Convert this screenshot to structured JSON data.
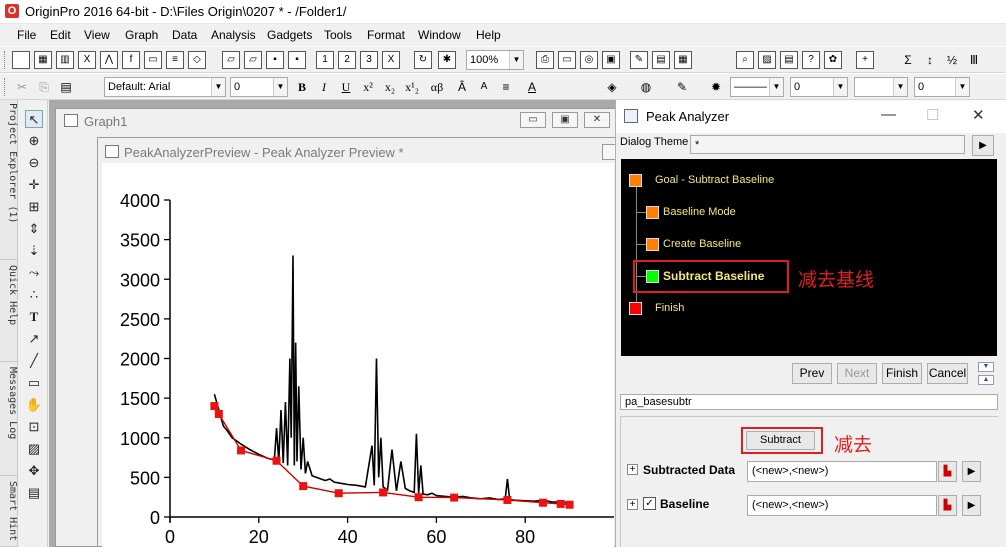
{
  "titlebar": {
    "title": "OriginPro 2016 64-bit - D:\\Files Origin\\0207 * - /Folder1/"
  },
  "menu": [
    "File",
    "Edit",
    "View",
    "Graph",
    "Data",
    "Analysis",
    "Gadgets",
    "Tools",
    "Format",
    "Window",
    "Help"
  ],
  "toolbar": {
    "zoom": "100%",
    "font": "Default: Arial",
    "font_size": "0",
    "text_style": [
      "B",
      "I",
      "U",
      "x²",
      "x₂",
      "x¹₂",
      "αβ",
      "Â",
      "A",
      "A",
      "≡"
    ],
    "line_combo": "0",
    "line_combo2": "0",
    "fill_combo": "0"
  },
  "side_tabs": [
    "Project Explorer (1)",
    "Quick Help",
    "Messages Log",
    "Smart Hint"
  ],
  "graph_window": {
    "title": "Graph1"
  },
  "preview_window": {
    "title": "PeakAnalyzerPreview - Peak Analyzer Preview *"
  },
  "chart_data": {
    "type": "line",
    "xlim": [
      0,
      100
    ],
    "ylim": [
      0,
      4000
    ],
    "x_ticks": [
      "0",
      "20",
      "40",
      "60",
      "80"
    ],
    "y_ticks": [
      "0",
      "500",
      "1000",
      "1500",
      "2000",
      "2500",
      "3000",
      "3500",
      "4000"
    ],
    "series": [
      {
        "kind": "signal",
        "color": "#000000",
        "x": [
          10,
          11,
          12,
          13,
          14,
          16,
          18,
          20,
          22,
          23.5,
          24,
          24.5,
          25,
          25.5,
          26,
          26.5,
          27,
          27.3,
          27.7,
          28,
          28.3,
          28.6,
          29,
          29.5,
          30,
          30.5,
          31,
          32,
          33,
          34,
          35,
          36,
          37,
          38,
          40,
          42,
          44,
          45.5,
          46,
          46.5,
          47,
          47.5,
          48,
          49,
          50,
          51,
          52,
          53,
          54,
          55,
          55.5,
          56,
          56.5,
          57,
          58,
          59,
          60,
          62,
          64,
          66,
          68,
          70,
          72,
          74,
          75.5,
          76,
          76.5,
          78,
          80,
          82,
          84,
          86,
          88,
          90
        ],
        "y": [
          1550,
          1350,
          1150,
          1080,
          1000,
          920,
          850,
          790,
          740,
          720,
          1120,
          700,
          1350,
          680,
          1450,
          650,
          2000,
          1000,
          3300,
          650,
          2200,
          700,
          1650,
          600,
          1000,
          550,
          700,
          520,
          500,
          480,
          460,
          480,
          440,
          430,
          410,
          400,
          380,
          900,
          400,
          2000,
          500,
          1000,
          380,
          340,
          850,
          330,
          700,
          360,
          330,
          310,
          1050,
          300,
          650,
          290,
          280,
          300,
          270,
          260,
          250,
          260,
          240,
          230,
          240,
          220,
          230,
          480,
          220,
          210,
          205,
          200,
          210,
          190,
          185,
          180
        ]
      },
      {
        "kind": "baseline",
        "color": "#cc0000",
        "x": [
          10,
          11,
          16,
          24,
          30,
          38,
          48,
          56,
          64,
          76,
          84,
          88,
          90
        ],
        "y": [
          1400,
          1300,
          840,
          710,
          390,
          300,
          310,
          250,
          245,
          215,
          180,
          165,
          155
        ]
      }
    ]
  },
  "peak_analyzer": {
    "title": "Peak Analyzer",
    "dialog_theme_label": "Dialog Theme",
    "dialog_theme_value": "*",
    "steps": [
      {
        "label": "Goal - Subtract Baseline",
        "color": "#ff8000"
      },
      {
        "label": "Baseline Mode",
        "color": "#ff8000"
      },
      {
        "label": "Create Baseline",
        "color": "#ff8000"
      },
      {
        "label": "Subtract Baseline",
        "color": "#00ff00"
      },
      {
        "label": "Finish",
        "color": "#ff0000"
      }
    ],
    "annotation_step": "减去基线",
    "nav": {
      "prev": "Prev",
      "next": "Next",
      "finish": "Finish",
      "cancel": "Cancel"
    },
    "theme_field": "pa_basesubtr",
    "subtract_button": "Subtract",
    "annotation_subtract": "减去",
    "subtracted_data_label": "Subtracted Data",
    "subtracted_data_value": "(<new>,<new>)",
    "baseline_label": "Baseline",
    "baseline_value": "(<new>,<new>)"
  }
}
